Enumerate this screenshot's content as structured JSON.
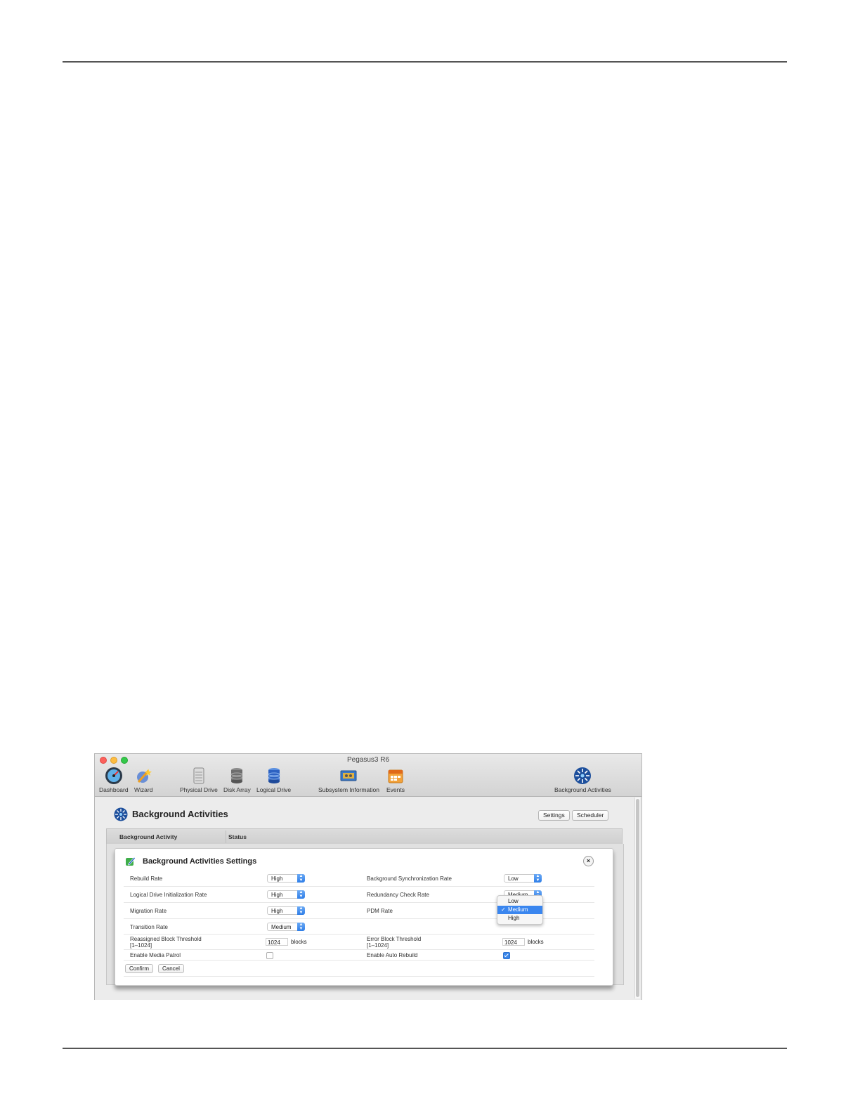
{
  "window": {
    "title": "Pegasus3 R6"
  },
  "toolbar": {
    "items": [
      {
        "label": "Dashboard",
        "icon": "dashboard-gauge-icon"
      },
      {
        "label": "Wizard",
        "icon": "wizard-icon"
      },
      {
        "label": "Physical Drive",
        "icon": "physical-drive-icon"
      },
      {
        "label": "Disk Array",
        "icon": "disk-array-icon"
      },
      {
        "label": "Logical Drive",
        "icon": "logical-drive-icon"
      },
      {
        "label": "Subsystem Information",
        "icon": "subsystem-info-icon"
      },
      {
        "label": "Events",
        "icon": "events-calendar-icon"
      },
      {
        "label": "Background Activities",
        "icon": "background-activities-icon"
      }
    ]
  },
  "main": {
    "title": "Background Activities",
    "settings_button": "Settings",
    "scheduler_button": "Scheduler",
    "table": {
      "columns": [
        "Background Activity",
        "Status"
      ]
    }
  },
  "dialog": {
    "title": "Background Activities Settings",
    "close_symbol": "×",
    "left": {
      "rebuild_rate": {
        "label": "Rebuild Rate",
        "value": "High"
      },
      "ld_init_rate": {
        "label": "Logical Drive Initialization Rate",
        "value": "High"
      },
      "migration_rate": {
        "label": "Migration Rate",
        "value": "High"
      },
      "transition_rate": {
        "label": "Transition Rate",
        "value": "Medium"
      },
      "reassigned_threshold": {
        "label": "Reassigned Block Threshold",
        "range": "[1–1024]",
        "value": "1024",
        "unit": "blocks"
      },
      "media_patrol": {
        "label": "Enable Media Patrol",
        "checked": false
      }
    },
    "right": {
      "bg_sync_rate": {
        "label": "Background Synchronization Rate",
        "value": "Low"
      },
      "redundancy_check_rate": {
        "label": "Redundancy Check Rate",
        "value": "Medium"
      },
      "pdm_rate": {
        "label": "PDM Rate"
      },
      "error_threshold": {
        "label": "Error Block Threshold",
        "range": "[1–1024]",
        "value": "1024",
        "unit": "blocks"
      },
      "auto_rebuild": {
        "label": "Enable Auto Rebuild",
        "checked": true
      }
    },
    "dropdown": {
      "options": [
        "Low",
        "Medium",
        "High"
      ],
      "selected": "Medium",
      "check": "✓"
    },
    "confirm_button": "Confirm",
    "cancel_button": "Cancel"
  },
  "colors": {
    "accent": "#3a86ef",
    "close_red": "#fc605b",
    "minimize_yellow": "#fdbc40",
    "zoom_green": "#34c84a"
  }
}
